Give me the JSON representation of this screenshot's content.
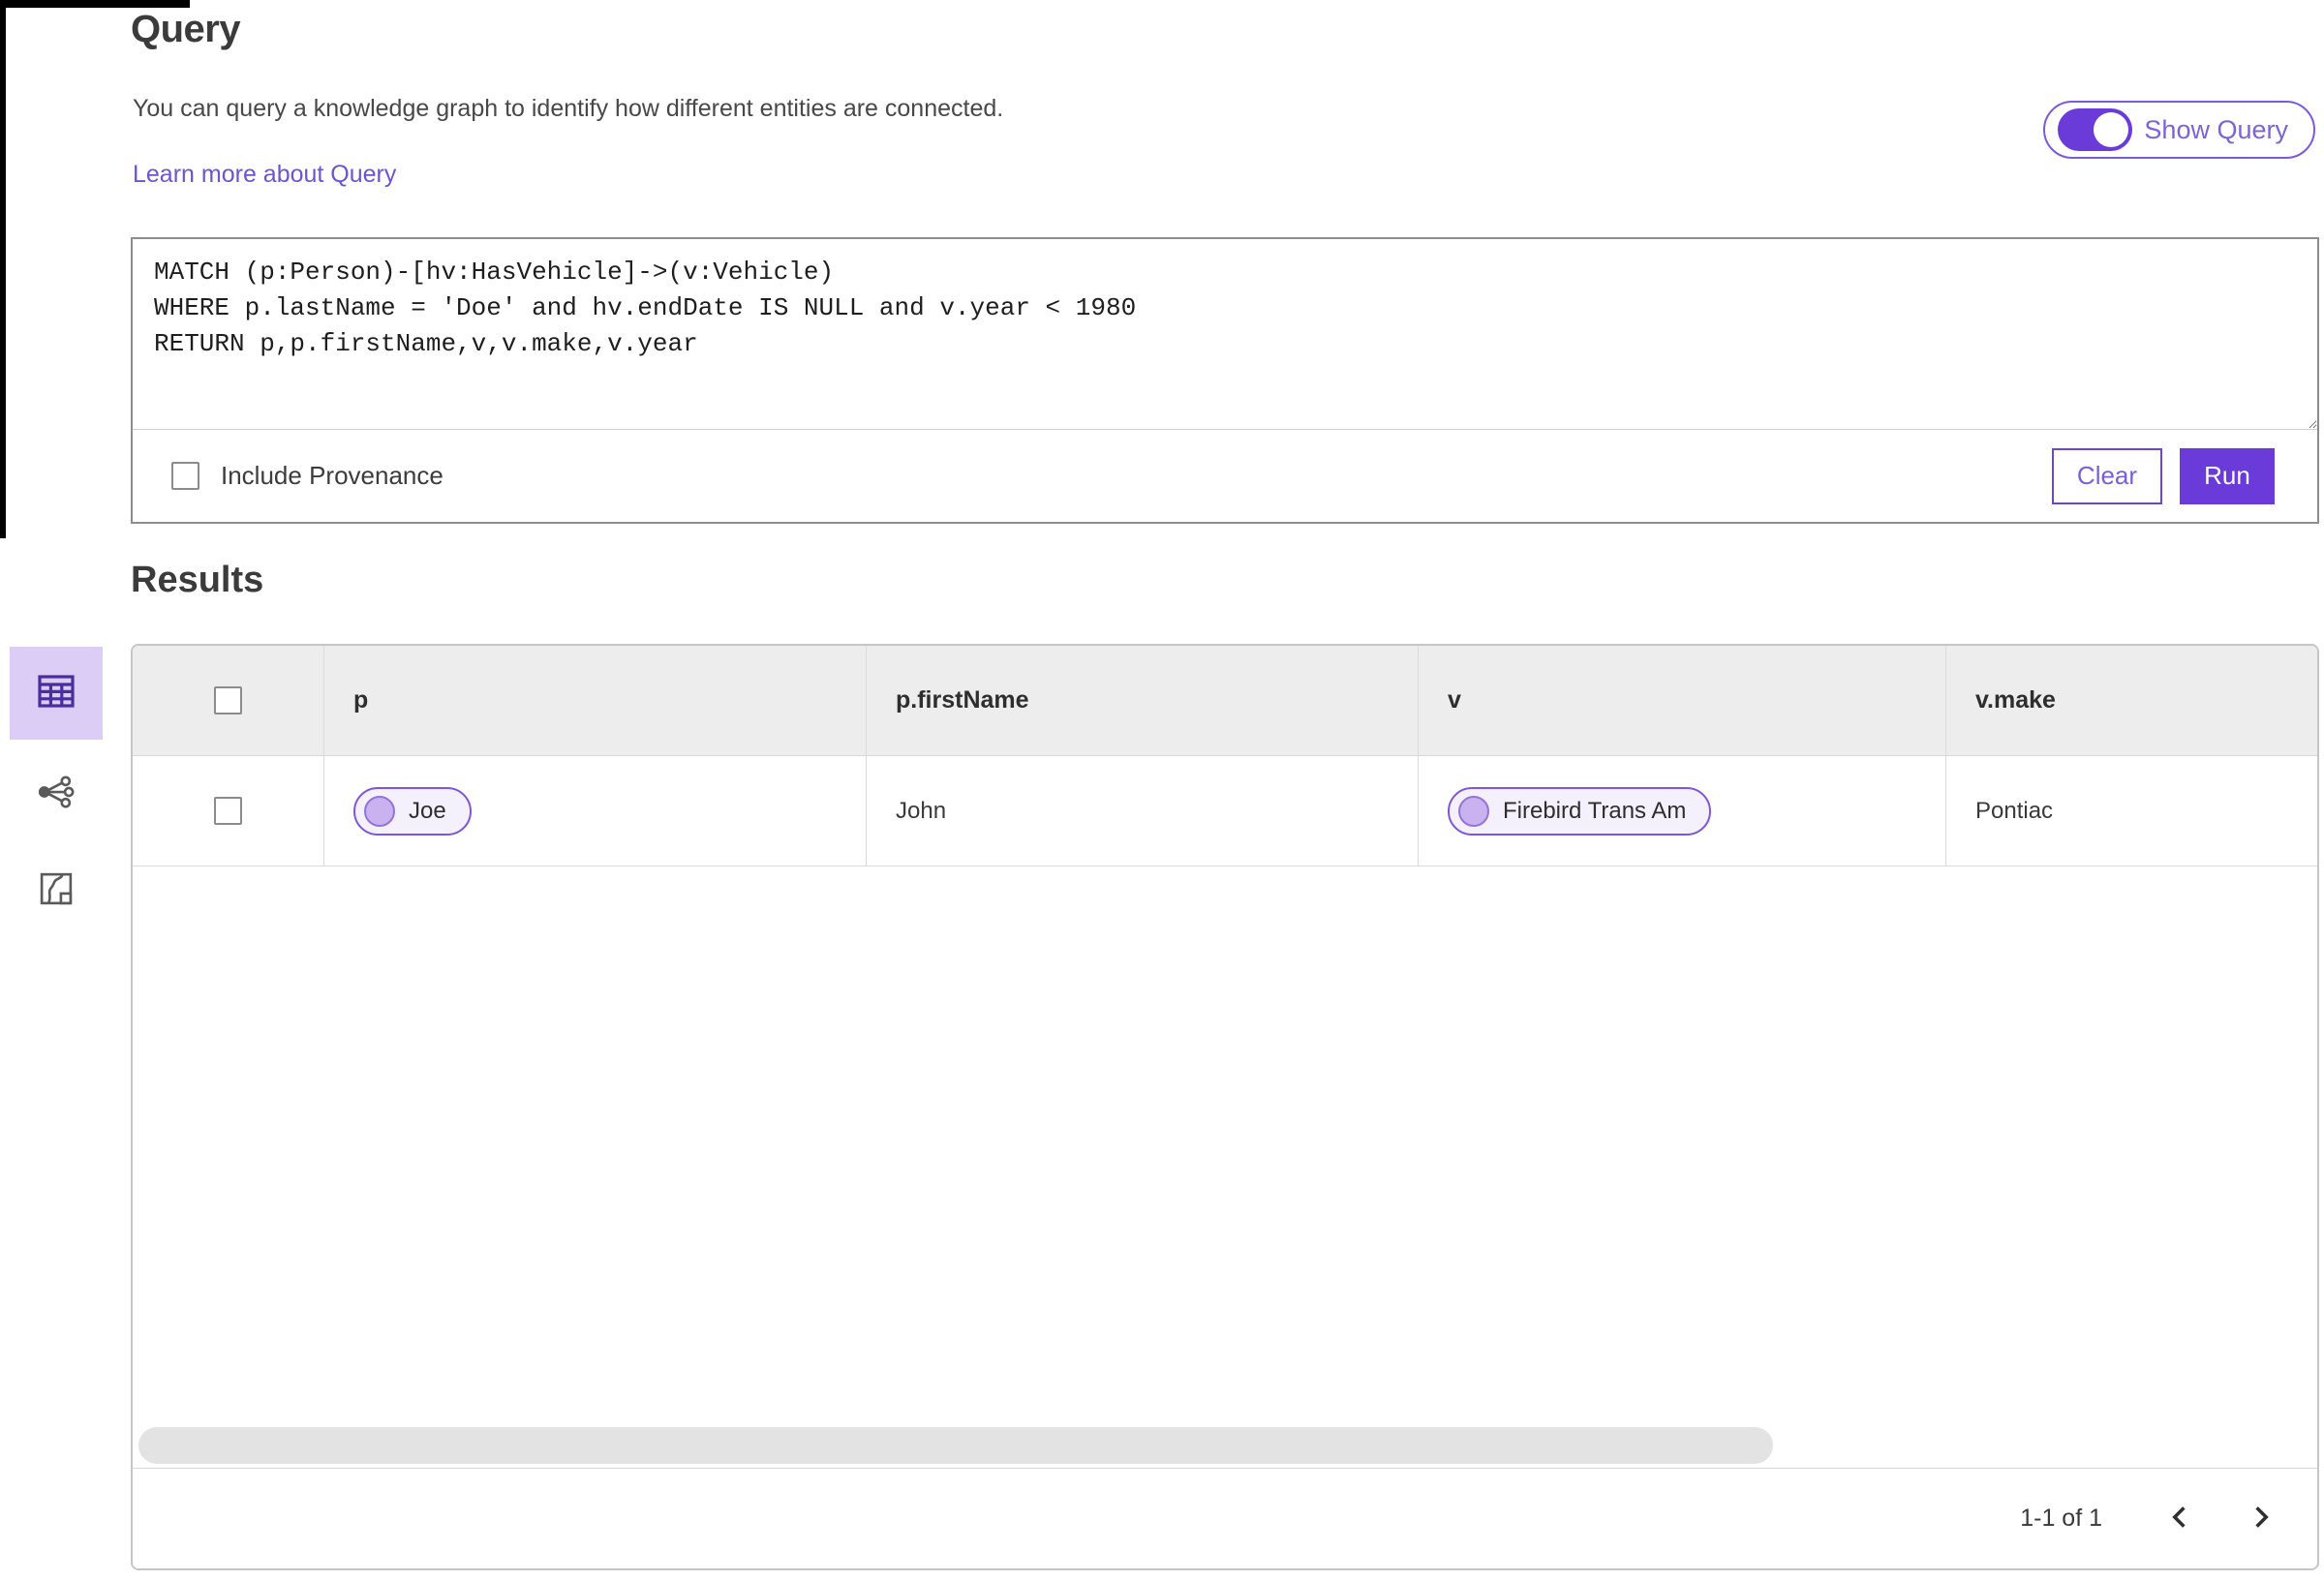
{
  "header": {
    "title": "Query",
    "description": "You can query a knowledge graph to identify how different entities are connected.",
    "learn_more_link": "Learn more about Query",
    "show_query": {
      "label": "Show Query",
      "state": "on"
    }
  },
  "query_editor": {
    "code": "MATCH (p:Person)-[hv:HasVehicle]->(v:Vehicle)\nWHERE p.lastName = 'Doe' and hv.endDate IS NULL and v.year < 1980\nRETURN p,p.firstName,v,v.make,v.year",
    "include_provenance": {
      "label": "Include Provenance",
      "checked": false
    },
    "buttons": {
      "clear": "Clear",
      "run": "Run"
    }
  },
  "results": {
    "heading": "Results",
    "view_switcher": [
      {
        "name": "table-view",
        "selected": true
      },
      {
        "name": "network-view",
        "selected": false
      },
      {
        "name": "map-view",
        "selected": false
      }
    ],
    "table": {
      "columns": [
        "p",
        "p.firstName",
        "v",
        "v.make"
      ],
      "rows": [
        {
          "p": "Joe",
          "p_firstName": "John",
          "v": "Firebird Trans Am",
          "v_make": "Pontiac"
        }
      ]
    },
    "pagination": {
      "range_label": "1-1 of 1"
    }
  },
  "colors": {
    "accent_purple": "#6a3bd8",
    "icon_purple": "#4a2d9e",
    "selected_tile_bg": "#dccdf7",
    "chip_border": "#7e57d8",
    "chip_bg": "#f5f1fc",
    "link_purple": "#6d54d2",
    "table_header_bg": "#ededed"
  }
}
